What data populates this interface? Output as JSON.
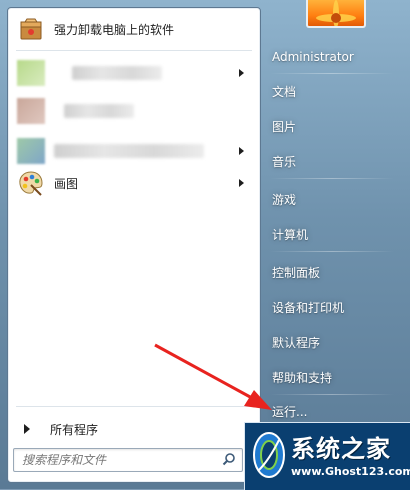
{
  "left_panel": {
    "items": [
      {
        "label": "强力卸载电脑上的软件",
        "icon": "uninstall-box-icon",
        "has_arrow": false
      },
      {
        "label": "",
        "icon": "blurred-app-icon",
        "has_arrow": true
      },
      {
        "label": "",
        "icon": "blurred-app-icon",
        "has_arrow": false
      },
      {
        "label": "",
        "icon": "blurred-app-icon",
        "has_arrow": true
      },
      {
        "label": "画图",
        "icon": "paint-palette-icon",
        "has_arrow": true
      }
    ],
    "all_programs": "所有程序",
    "search": {
      "placeholder": "搜索程序和文件"
    }
  },
  "right_panel": {
    "items": [
      "Administrator",
      "文档",
      "图片",
      "音乐",
      "游戏",
      "计算机",
      "控制面板",
      "设备和打印机",
      "默认程序",
      "帮助和支持",
      "运行..."
    ]
  },
  "watermark": {
    "title": "系统之家",
    "url": "www.Ghost123.com"
  },
  "colors": {
    "annotation_arrow": "#e8231f",
    "watermark_bg": "#0a3f70"
  }
}
